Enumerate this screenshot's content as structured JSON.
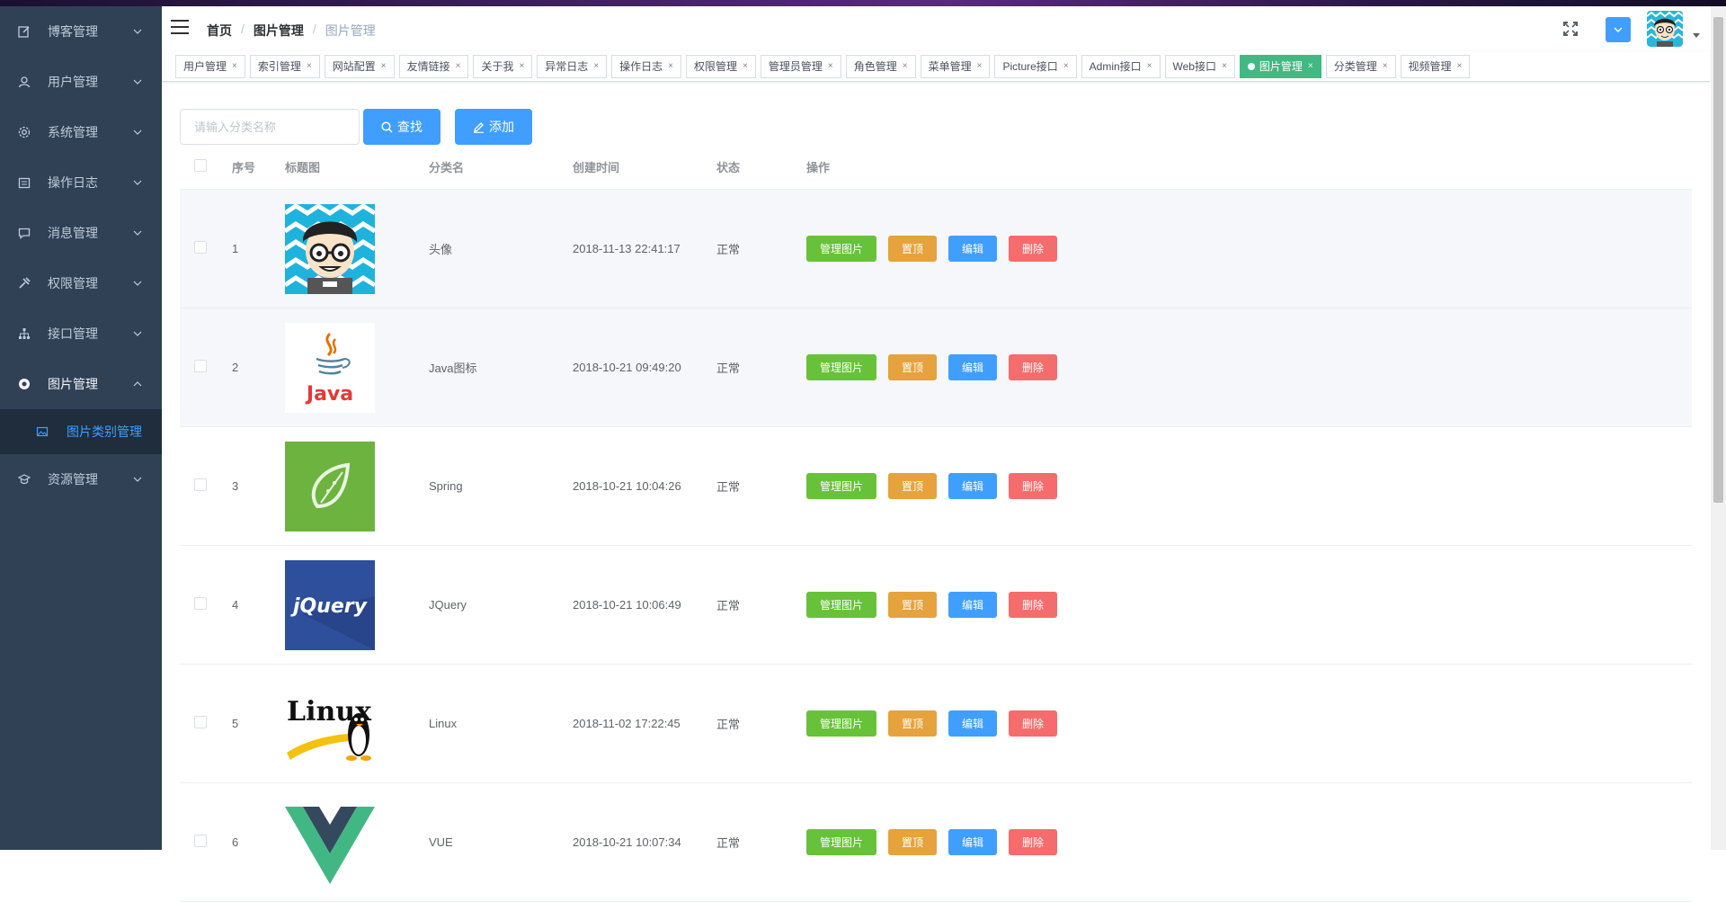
{
  "sidebar": {
    "items": [
      {
        "label": "博客管理",
        "icon": "edit-icon"
      },
      {
        "label": "用户管理",
        "icon": "user-icon"
      },
      {
        "label": "系统管理",
        "icon": "gear-icon"
      },
      {
        "label": "操作日志",
        "icon": "calendar-icon"
      },
      {
        "label": "消息管理",
        "icon": "message-icon"
      },
      {
        "label": "权限管理",
        "icon": "tools-icon"
      },
      {
        "label": "接口管理",
        "icon": "network-icon"
      },
      {
        "label": "图片管理",
        "icon": "aperture-icon"
      },
      {
        "label": "资源管理",
        "icon": "graduation-icon"
      }
    ],
    "submenu": {
      "label": "图片类别管理",
      "icon": "picture-icon"
    }
  },
  "breadcrumb": [
    "首页",
    "图片管理",
    "图片管理"
  ],
  "tags": [
    "用户管理",
    "索引管理",
    "网站配置",
    "友情链接",
    "关于我",
    "异常日志",
    "操作日志",
    "权限管理",
    "管理员管理",
    "角色管理",
    "菜单管理",
    "Picture接口",
    "Admin接口",
    "Web接口",
    "图片管理",
    "分类管理",
    "视频管理"
  ],
  "active_tag": "图片管理",
  "filter": {
    "placeholder": "请输入分类名称",
    "search_label": "查找",
    "add_label": "添加"
  },
  "table": {
    "headers": {
      "index": "序号",
      "image": "标题图",
      "name": "分类名",
      "time": "创建时间",
      "status": "状态",
      "ops": "操作"
    },
    "rows": [
      {
        "index": "1",
        "name": "头像",
        "time": "2018-11-13 22:41:17",
        "status": "正常",
        "image": "avatar-image"
      },
      {
        "index": "2",
        "name": "Java图标",
        "time": "2018-10-21 09:49:20",
        "status": "正常",
        "image": "java-logo"
      },
      {
        "index": "3",
        "name": "Spring",
        "time": "2018-10-21 10:04:26",
        "status": "正常",
        "image": "spring-logo"
      },
      {
        "index": "4",
        "name": "JQuery",
        "time": "2018-10-21 10:06:49",
        "status": "正常",
        "image": "jquery-logo"
      },
      {
        "index": "5",
        "name": "Linux",
        "time": "2018-11-02 17:22:45",
        "status": "正常",
        "image": "linux-logo"
      },
      {
        "index": "6",
        "name": "VUE",
        "time": "2018-10-21 10:07:34",
        "status": "正常",
        "image": "vue-logo"
      }
    ],
    "ops": {
      "manage": "管理图片",
      "top": "置顶",
      "edit": "编辑",
      "delete": "删除"
    }
  },
  "colors": {
    "sidebar_bg": "#304156",
    "primary": "#409eff",
    "success": "#67c23a",
    "warning": "#e6a23c",
    "danger": "#f56c6c",
    "tag_active": "#42b983"
  }
}
